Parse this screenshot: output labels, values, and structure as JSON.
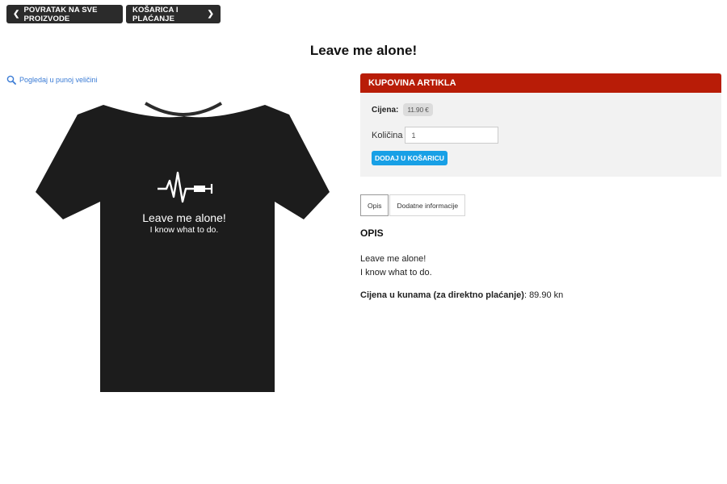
{
  "nav": {
    "back_label": "POVRATAK NA SVE PROIZVODE",
    "cart_label": "KOŠARICA I PLAĆANJE"
  },
  "product": {
    "title": "Leave me alone!",
    "zoom_label": "Pogledaj u punoj veličini",
    "shirt_text_line1": "Leave me alone!",
    "shirt_text_line2": "I know what to do."
  },
  "buy_panel": {
    "header": "KUPOVINA ARTIKLA",
    "price_label": "Cijena:",
    "price_value": "11.90 €",
    "quantity_label": "Količina",
    "quantity_value": "1",
    "add_to_cart_label": "DODAJ U KOŠARICU"
  },
  "tabs": {
    "description": "Opis",
    "additional_info": "Dodatne informacije"
  },
  "description": {
    "heading": "OPIS",
    "line1": "Leave me alone!",
    "line2": "I know what to do.",
    "price_kn_label": "Cijena u kunama (za direktno plaćanje)",
    "price_kn_value": ": 89.90 kn"
  },
  "colors": {
    "nav_bg": "#2b2b2b",
    "panel_header": "#b81c07",
    "add_button": "#18a0e6",
    "link": "#3a7bd5"
  }
}
